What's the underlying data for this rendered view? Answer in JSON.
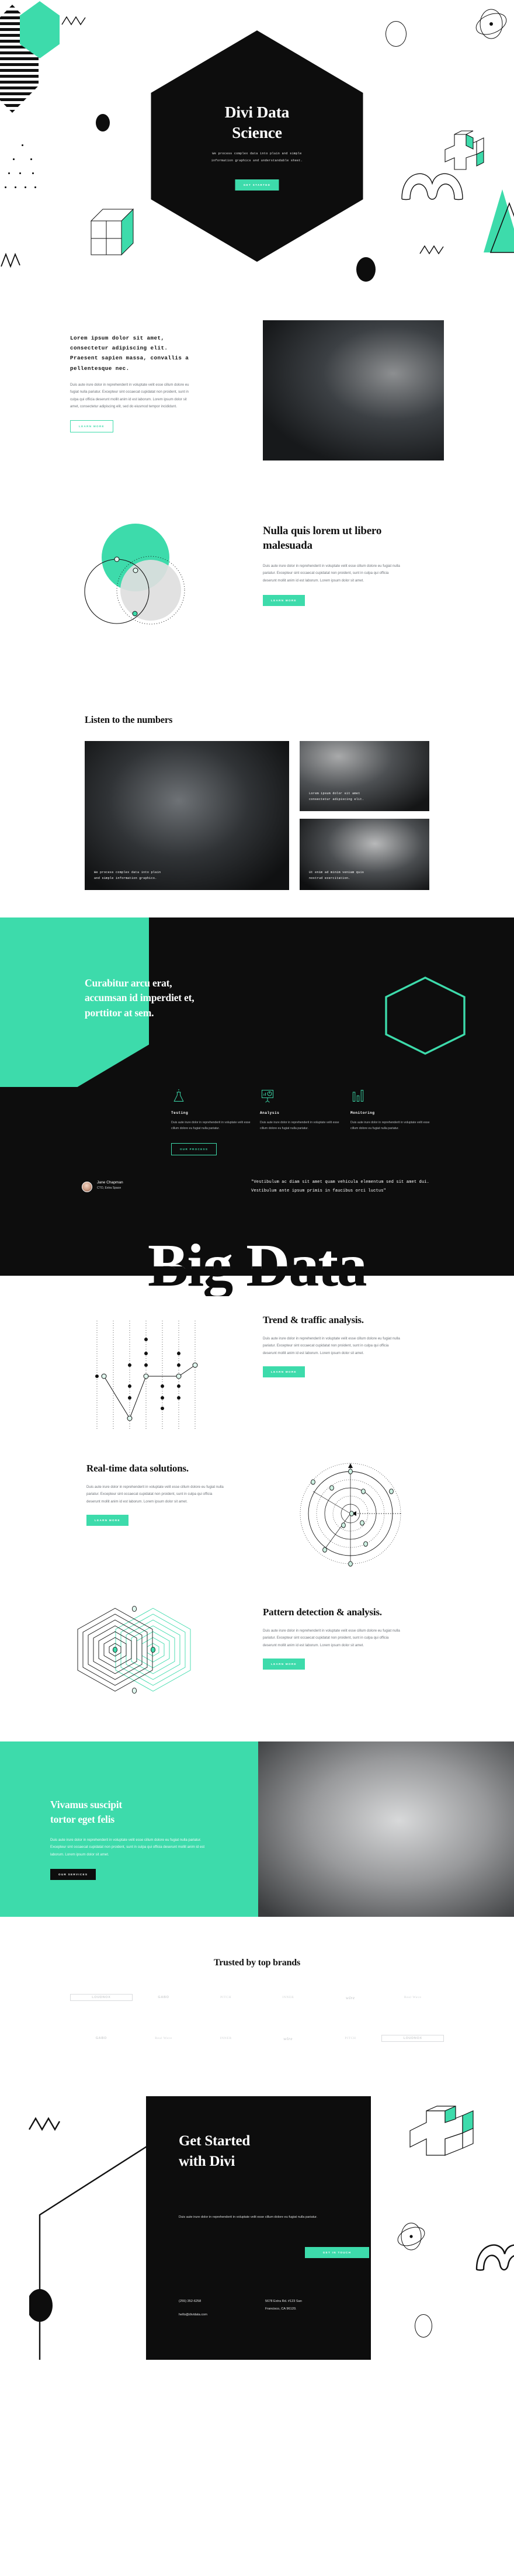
{
  "colors": {
    "accent": "#3ddbab",
    "dark": "#0d0d0d",
    "white": "#ffffff",
    "muted": "#6d7278"
  },
  "hero": {
    "title_line1": "Divi Data",
    "title_line2": "Science",
    "subtitle_line1": "We process complex data into plain and simple",
    "subtitle_line2": "information graphics and understandable sheet.",
    "cta": "GET STARTED"
  },
  "intro": {
    "heading": "Lorem ipsum dolor sit amet, consectetur adipiscing elit. Praesent sapien massa, convallis a pellentesque nec.",
    "body": "Duis aute irure dolor in reprehenderit in voluptate velit esse cillum dolore eu fugiat nulla pariatur. Excepteur sint occaecat cupidatat non proident, sunt in culpa qui officia deserunt mollit anim id est laborum. Lorem ipsum dolor sit amet, consectetur adipiscing elit, sed do eiusmod tempor incididunt.",
    "cta": "LEARN MORE"
  },
  "venn": {
    "heading": "Nulla quis lorem ut libero malesuada",
    "body": "Duis aute irure dolor in reprehenderit in voluptate velit esse cillum dolore eu fugiat nulla pariatur. Excepteur sint occaecat cupidatat non proident, sunt in culpa qui officia deserunt mollit anim id est laborum. Lorem ipsum dolor sit amet.",
    "cta": "LEARN MORE"
  },
  "gallery": {
    "heading": "Listen to the numbers",
    "caption_main_l1": "We process complex data into plain",
    "caption_main_l2": "and simple information graphics.",
    "caption_top_l1": "Lorem ipsum dolor sit amet",
    "caption_top_l2": "consectetur adipiscing elit.",
    "caption_bottom_l1": "Ut enim ad minim veniam quis",
    "caption_bottom_l2": "nostrud exercitation."
  },
  "dark": {
    "heading_l1": "Curabitur arcu erat,",
    "heading_l2": "accumsan id imperdiet et,",
    "heading_l3": "porttitor at sem.",
    "services": [
      {
        "icon": "flask-icon",
        "title": "Testing",
        "body": "Duis aute irure dolor in reprehenderit in voluptate velit esse cillum dolore eu fugiat nulla pariatur."
      },
      {
        "icon": "presentation-chart-icon",
        "title": "Analysis",
        "body": "Duis aute irure dolor in reprehenderit in voluptate velit esse cillum dolore eu fugiat nulla pariatur."
      },
      {
        "icon": "bar-chart-icon",
        "title": "Monitoring",
        "body": "Duis aute irure dolor in reprehenderit in voluptate velit esse cillum dolore eu fugiat nulla pariatur."
      }
    ],
    "cta": "OUR PROCESS",
    "testimonial": {
      "name": "Jane Chapman",
      "role": "CTO, Extra Space",
      "quote": "\"Vestibulum ac diam sit amet quam vehicula elementum sed sit amet dui. Vestibulum ante ipsum primis in faucibus orci luctus\""
    }
  },
  "bigword": {
    "text": "Big Data"
  },
  "features": [
    {
      "art": "scatter-line-chart",
      "heading": "Trend & traffic analysis.",
      "body": "Duis aute irure dolor in reprehenderit in voluptate velit esse cillum dolore eu fugiat nulla pariatur. Excepteur sint occaecat cupidatat non proident, sunt in culpa qui officia deserunt mollit anim id est laborum. Lorem ipsum dolor sit amet.",
      "cta": "LEARN MORE"
    },
    {
      "art": "radial-orbit-chart",
      "heading": "Real-time data solutions.",
      "body": "Duis aute irure dolor in reprehenderit in voluptate velit esse cillum dolore eu fugiat nulla pariatur. Excepteur sint occaecat cupidatat non proident, sunt in culpa qui officia deserunt mollit anim id est laborum. Lorem ipsum dolor sit amet.",
      "cta": "LEARN MORE"
    },
    {
      "art": "nested-hexagon-chart",
      "heading": "Pattern detection & analysis.",
      "body": "Duis aute irure dolor in reprehenderit in voluptate velit esse cillum dolore eu fugiat nulla pariatur. Excepteur sint occaecat cupidatat non proident, sunt in culpa qui officia deserunt mollit anim id est laborum. Lorem ipsum dolor sit amet.",
      "cta": "LEARN MORE"
    }
  ],
  "green_cta": {
    "heading_l1": "Vivamus suscipit",
    "heading_l2": "tortor eget felis",
    "body": "Duis aute irure dolor in reprehenderit in voluptate velit esse cillum dolore eu fugiat nulla pariatur. Excepteur sint occaecat cupidatat non proident, sunt in culpa qui officia deserunt mollit anim id est laborum. Lorem ipsum dolor sit amet.",
    "cta": "OUR SERVICES"
  },
  "brands": {
    "heading": "Trusted by top brands",
    "row1": [
      "LOUDNOX",
      "GABO",
      "PITCH",
      "INNER",
      "wire",
      "Real Wave"
    ],
    "row2": [
      "GABO",
      "Real Wave",
      "INNER",
      "wire",
      "PITCH",
      "LOUDNOX"
    ]
  },
  "footer": {
    "heading_l1": "Get Started",
    "heading_l2": "with Divi",
    "body": "Duis aute irure dolor in reprehenderit in voluptate velit esse cillum dolore eu fugiat nulla pariatur.",
    "cta": "GET IN TOUCH",
    "phone": "(255) 352-6258",
    "email": "hello@dividata.com",
    "address_l1": "5678 Extra Rd. #123 San",
    "address_l2": "Francisco, CA 96120."
  }
}
